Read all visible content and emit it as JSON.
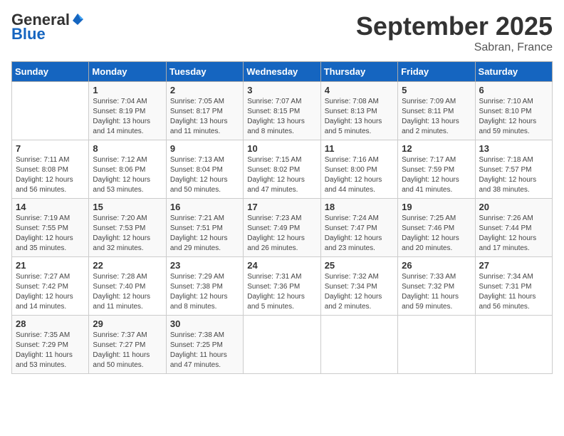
{
  "header": {
    "logo_general": "General",
    "logo_blue": "Blue",
    "month_title": "September 2025",
    "location": "Sabran, France"
  },
  "days_of_week": [
    "Sunday",
    "Monday",
    "Tuesday",
    "Wednesday",
    "Thursday",
    "Friday",
    "Saturday"
  ],
  "weeks": [
    [
      {
        "day": "",
        "info": ""
      },
      {
        "day": "1",
        "info": "Sunrise: 7:04 AM\nSunset: 8:19 PM\nDaylight: 13 hours\nand 14 minutes."
      },
      {
        "day": "2",
        "info": "Sunrise: 7:05 AM\nSunset: 8:17 PM\nDaylight: 13 hours\nand 11 minutes."
      },
      {
        "day": "3",
        "info": "Sunrise: 7:07 AM\nSunset: 8:15 PM\nDaylight: 13 hours\nand 8 minutes."
      },
      {
        "day": "4",
        "info": "Sunrise: 7:08 AM\nSunset: 8:13 PM\nDaylight: 13 hours\nand 5 minutes."
      },
      {
        "day": "5",
        "info": "Sunrise: 7:09 AM\nSunset: 8:11 PM\nDaylight: 13 hours\nand 2 minutes."
      },
      {
        "day": "6",
        "info": "Sunrise: 7:10 AM\nSunset: 8:10 PM\nDaylight: 12 hours\nand 59 minutes."
      }
    ],
    [
      {
        "day": "7",
        "info": "Sunrise: 7:11 AM\nSunset: 8:08 PM\nDaylight: 12 hours\nand 56 minutes."
      },
      {
        "day": "8",
        "info": "Sunrise: 7:12 AM\nSunset: 8:06 PM\nDaylight: 12 hours\nand 53 minutes."
      },
      {
        "day": "9",
        "info": "Sunrise: 7:13 AM\nSunset: 8:04 PM\nDaylight: 12 hours\nand 50 minutes."
      },
      {
        "day": "10",
        "info": "Sunrise: 7:15 AM\nSunset: 8:02 PM\nDaylight: 12 hours\nand 47 minutes."
      },
      {
        "day": "11",
        "info": "Sunrise: 7:16 AM\nSunset: 8:00 PM\nDaylight: 12 hours\nand 44 minutes."
      },
      {
        "day": "12",
        "info": "Sunrise: 7:17 AM\nSunset: 7:59 PM\nDaylight: 12 hours\nand 41 minutes."
      },
      {
        "day": "13",
        "info": "Sunrise: 7:18 AM\nSunset: 7:57 PM\nDaylight: 12 hours\nand 38 minutes."
      }
    ],
    [
      {
        "day": "14",
        "info": "Sunrise: 7:19 AM\nSunset: 7:55 PM\nDaylight: 12 hours\nand 35 minutes."
      },
      {
        "day": "15",
        "info": "Sunrise: 7:20 AM\nSunset: 7:53 PM\nDaylight: 12 hours\nand 32 minutes."
      },
      {
        "day": "16",
        "info": "Sunrise: 7:21 AM\nSunset: 7:51 PM\nDaylight: 12 hours\nand 29 minutes."
      },
      {
        "day": "17",
        "info": "Sunrise: 7:23 AM\nSunset: 7:49 PM\nDaylight: 12 hours\nand 26 minutes."
      },
      {
        "day": "18",
        "info": "Sunrise: 7:24 AM\nSunset: 7:47 PM\nDaylight: 12 hours\nand 23 minutes."
      },
      {
        "day": "19",
        "info": "Sunrise: 7:25 AM\nSunset: 7:46 PM\nDaylight: 12 hours\nand 20 minutes."
      },
      {
        "day": "20",
        "info": "Sunrise: 7:26 AM\nSunset: 7:44 PM\nDaylight: 12 hours\nand 17 minutes."
      }
    ],
    [
      {
        "day": "21",
        "info": "Sunrise: 7:27 AM\nSunset: 7:42 PM\nDaylight: 12 hours\nand 14 minutes."
      },
      {
        "day": "22",
        "info": "Sunrise: 7:28 AM\nSunset: 7:40 PM\nDaylight: 12 hours\nand 11 minutes."
      },
      {
        "day": "23",
        "info": "Sunrise: 7:29 AM\nSunset: 7:38 PM\nDaylight: 12 hours\nand 8 minutes."
      },
      {
        "day": "24",
        "info": "Sunrise: 7:31 AM\nSunset: 7:36 PM\nDaylight: 12 hours\nand 5 minutes."
      },
      {
        "day": "25",
        "info": "Sunrise: 7:32 AM\nSunset: 7:34 PM\nDaylight: 12 hours\nand 2 minutes."
      },
      {
        "day": "26",
        "info": "Sunrise: 7:33 AM\nSunset: 7:32 PM\nDaylight: 11 hours\nand 59 minutes."
      },
      {
        "day": "27",
        "info": "Sunrise: 7:34 AM\nSunset: 7:31 PM\nDaylight: 11 hours\nand 56 minutes."
      }
    ],
    [
      {
        "day": "28",
        "info": "Sunrise: 7:35 AM\nSunset: 7:29 PM\nDaylight: 11 hours\nand 53 minutes."
      },
      {
        "day": "29",
        "info": "Sunrise: 7:37 AM\nSunset: 7:27 PM\nDaylight: 11 hours\nand 50 minutes."
      },
      {
        "day": "30",
        "info": "Sunrise: 7:38 AM\nSunset: 7:25 PM\nDaylight: 11 hours\nand 47 minutes."
      },
      {
        "day": "",
        "info": ""
      },
      {
        "day": "",
        "info": ""
      },
      {
        "day": "",
        "info": ""
      },
      {
        "day": "",
        "info": ""
      }
    ]
  ]
}
